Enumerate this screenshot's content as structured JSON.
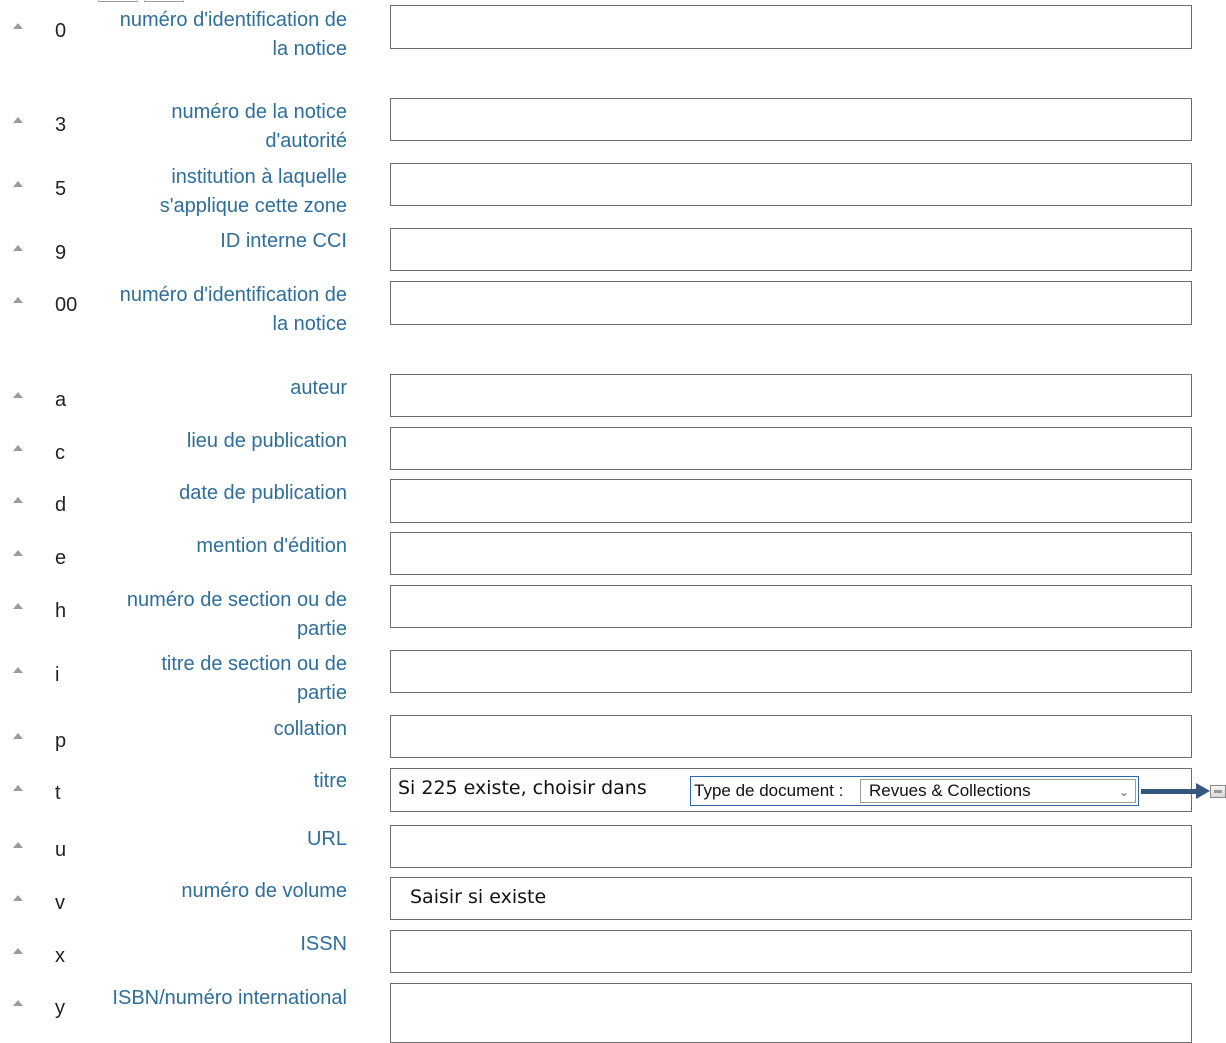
{
  "fields": [
    {
      "code": "0",
      "label": "numéro d'identification de la notice",
      "value": ""
    },
    {
      "code": "3",
      "label": "numéro de la notice d'autorité",
      "value": ""
    },
    {
      "code": "5",
      "label": "institution à laquelle s'applique cette zone",
      "value": ""
    },
    {
      "code": "9",
      "label": "ID interne CCI",
      "value": ""
    },
    {
      "code": "00",
      "label": "numéro d'identification de la notice",
      "value": ""
    },
    {
      "code": "a",
      "label": "auteur",
      "value": ""
    },
    {
      "code": "c",
      "label": "lieu de publication",
      "value": ""
    },
    {
      "code": "d",
      "label": "date de publication",
      "value": ""
    },
    {
      "code": "e",
      "label": "mention d'édition",
      "value": ""
    },
    {
      "code": "h",
      "label": "numéro de section ou de partie",
      "value": ""
    },
    {
      "code": "i",
      "label": "titre de section ou de partie",
      "value": ""
    },
    {
      "code": "p",
      "label": "collation",
      "value": ""
    },
    {
      "code": "t",
      "label": "titre",
      "value": ""
    },
    {
      "code": "u",
      "label": "URL",
      "value": ""
    },
    {
      "code": "v",
      "label": "numéro de volume",
      "value": ""
    },
    {
      "code": "x",
      "label": "ISSN",
      "value": ""
    },
    {
      "code": "y",
      "label": "ISBN/numéro international",
      "value": ""
    }
  ],
  "annotations": {
    "titre_note": "Si 225 existe, choisir dans",
    "doc_type_label": "Type de document :",
    "doc_type_selected": "Revues & Collections",
    "volume_note": "Saisir si existe"
  },
  "icons": {
    "move_up": "triangle-up-icon",
    "select_chevron": "chevron-down-icon",
    "annotation_arrow": "arrow-right-icon",
    "lookup": "lookup-icon"
  },
  "colors": {
    "label": "#2e6e9a",
    "annotation_arrow": "#35567f",
    "select_border": "#2f66b3"
  }
}
